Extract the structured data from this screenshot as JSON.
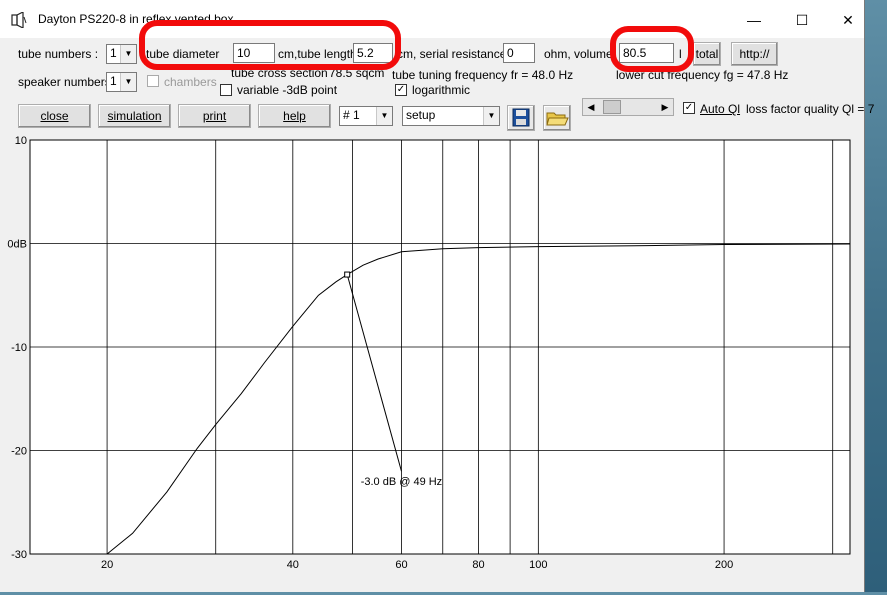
{
  "window": {
    "title": "Dayton PS220-8 in reflex vented box",
    "controls": {
      "minimize": "—",
      "maximize": "☐",
      "close": "✕"
    }
  },
  "row1": {
    "tube_numbers_label": "tube numbers :",
    "tube_numbers_value": "1",
    "tube_diameter_label": "tube diameter",
    "tube_diameter_value": "10",
    "tube_length_label": "cm,tube length",
    "tube_length_value": "5.2",
    "serial_resistance_label": "cm, serial resistance",
    "serial_resistance_value": "0",
    "volume_label": "ohm, volume",
    "volume_value": "80.5",
    "volume_unit": "l",
    "total_button": "total",
    "http_button": "http://"
  },
  "row2": {
    "speaker_numbers_label": "speaker numbers :",
    "speaker_numbers_value": "1",
    "chambers_label": "chambers",
    "tube_cross_section_label": "tube cross section",
    "tube_cross_section_value": "78.5 sqcm",
    "variable_3db_label": "variable -3dB point",
    "tube_tuning_label": "tube tuning frequency fr = 48.0 Hz",
    "logarithmic_label": "logarithmic",
    "lower_cut_label": "lower cut frequency fg = 47.8 Hz",
    "logarithmic_checked": "✓"
  },
  "row3": {
    "close_button": "close",
    "simulation_button": "simulation",
    "print_button": "print",
    "help_button": "help",
    "number_select": "# 1",
    "setup_select": "setup",
    "auto_ql_label": "Auto Ql",
    "auto_ql_checked": "✓",
    "loss_factor_label": "loss factor quality Ql = 7"
  },
  "icons": {
    "save": "floppy-disk-icon",
    "open": "open-folder-icon",
    "app": "speaker-app-icon"
  },
  "colors": {
    "annotation": "#f20b0b",
    "chart_bg": "#ffffff",
    "window_bg": "#f0f0f0"
  },
  "chart_data": {
    "type": "line",
    "xscale": "log",
    "xlim": [
      15,
      320
    ],
    "ylim": [
      -30,
      10
    ],
    "yticks": [
      {
        "value": 10,
        "label": "10"
      },
      {
        "value": 0,
        "label": "0dB"
      },
      {
        "value": -10,
        "label": "-10"
      },
      {
        "value": -20,
        "label": "-20"
      },
      {
        "value": -30,
        "label": "-30"
      }
    ],
    "xgrid": [
      20,
      30,
      40,
      50,
      60,
      70,
      80,
      90,
      100,
      200,
      300
    ],
    "xticks": [
      {
        "value": 20,
        "label": "20"
      },
      {
        "value": 40,
        "label": "40"
      },
      {
        "value": 60,
        "label": "60"
      },
      {
        "value": 80,
        "label": "80"
      },
      {
        "value": 100,
        "label": "100"
      },
      {
        "value": 200,
        "label": "200"
      }
    ],
    "grid": true,
    "series": [
      {
        "x": [
          20,
          22,
          25,
          28,
          30,
          33,
          36,
          40,
          44,
          47,
          49,
          52,
          55,
          60,
          70,
          80,
          100,
          150,
          200,
          320
        ],
        "y": [
          -30,
          -28,
          -24,
          -19.8,
          -17.5,
          -14.5,
          -11.5,
          -8,
          -5,
          -3.7,
          -3.0,
          -2.1,
          -1.5,
          -0.8,
          -0.5,
          -0.4,
          -0.3,
          -0.2,
          -0.1,
          -0.05
        ]
      }
    ],
    "annotation": {
      "x": 49,
      "y": -3.0,
      "label": "-3.0 dB @  49 Hz",
      "label_x": 60,
      "label_y": -22
    }
  }
}
